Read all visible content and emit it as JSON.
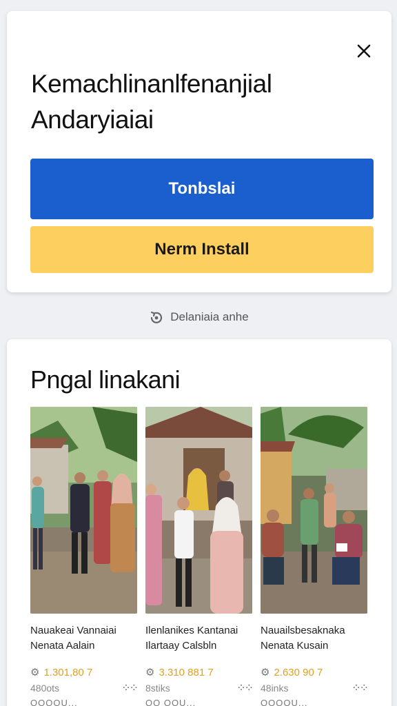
{
  "dialog": {
    "title_line1": "Kemachlinanlfenanjial",
    "title_line2": "Andaryiaiai",
    "primary_label": "Tonbslai",
    "secondary_label": "Nerm Install"
  },
  "link": {
    "label": "Delaniaia anhe"
  },
  "section": {
    "title": "Pngal linakani",
    "items": [
      {
        "caption1": "Nauakeai Vannaiai",
        "caption2": "Nenata Aalain",
        "price": "1.301,80 7",
        "meta": "480ots",
        "footer": "QOQOU..."
      },
      {
        "caption1": "Ilenlanikes Kantanai",
        "caption2": "Ilartaay Calsbln",
        "price": "3.310 881 7",
        "meta": "8stiks",
        "footer": "QQ QOU..."
      },
      {
        "caption1": "Nauailsbesaknaka",
        "caption2": "Nenata Kusain",
        "price": "2.630 90 7",
        "meta": "48inks",
        "footer": "QOQOU..."
      }
    ]
  },
  "colors": {
    "primary": "#1b5fcf",
    "secondary": "#fdcf5e"
  }
}
